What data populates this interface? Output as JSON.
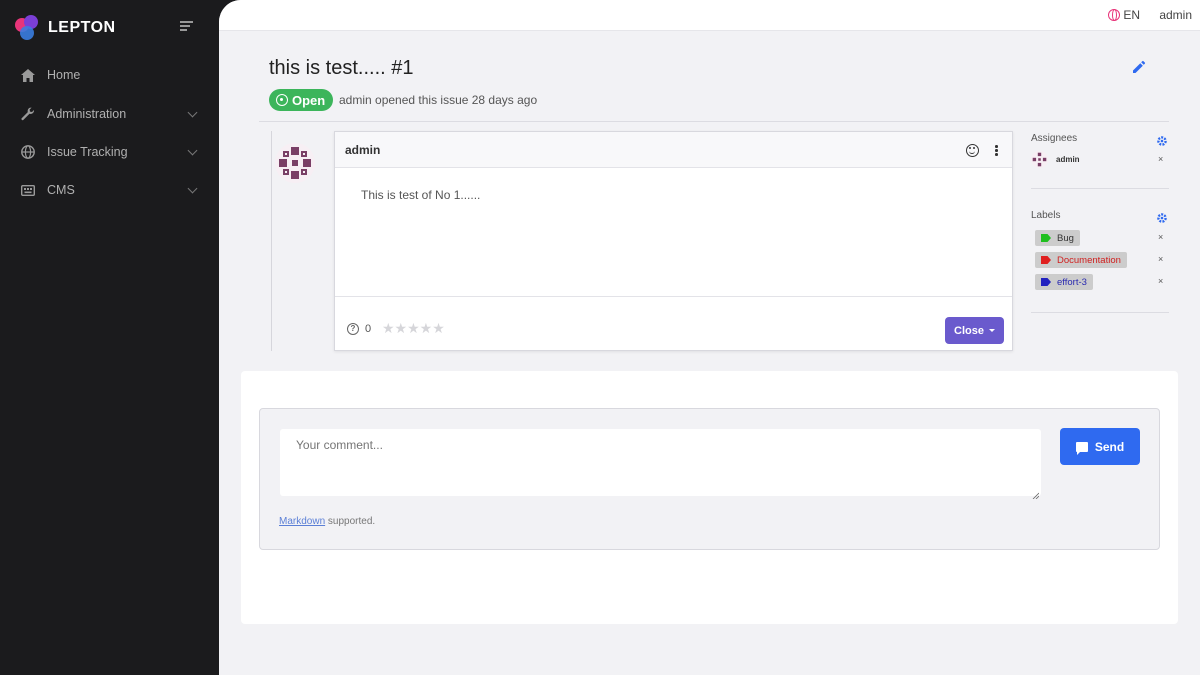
{
  "brand": {
    "name": "LEPTON"
  },
  "sidebar": {
    "items": [
      {
        "label": "Home",
        "icon": "home-icon"
      },
      {
        "label": "Administration",
        "icon": "wrench-icon"
      },
      {
        "label": "Issue Tracking",
        "icon": "globe-icon"
      },
      {
        "label": "CMS",
        "icon": "keyboard-icon"
      }
    ]
  },
  "topbar": {
    "language": "EN",
    "user": "admin"
  },
  "issue": {
    "title": "this is test..... #1",
    "status": "Open",
    "meta": "admin opened this issue 28 days ago"
  },
  "comment": {
    "author": "admin",
    "body": "This is test of No 1......",
    "vote_count": "0",
    "stars": "★★★★★",
    "close_label": "Close"
  },
  "side": {
    "assignees_title": "Assignees",
    "assignee_name": "admin",
    "labels_title": "Labels",
    "labels": [
      {
        "name": "Bug",
        "color": "#1fbf1f"
      },
      {
        "name": "Documentation",
        "color": "#e02020"
      },
      {
        "name": "effort-3",
        "color": "#2222c0"
      }
    ],
    "remove_symbol": "×"
  },
  "new_comment": {
    "placeholder": "Your comment...",
    "send_label": "Send",
    "markdown_link": "Markdown",
    "markdown_suffix": " supported."
  },
  "colors": {
    "sidebar_bg": "#1b1b1d",
    "open_badge": "#3cb55b",
    "close_button": "#6a5acd",
    "send_button": "#2f6af0",
    "accent": "#2f6af0"
  }
}
